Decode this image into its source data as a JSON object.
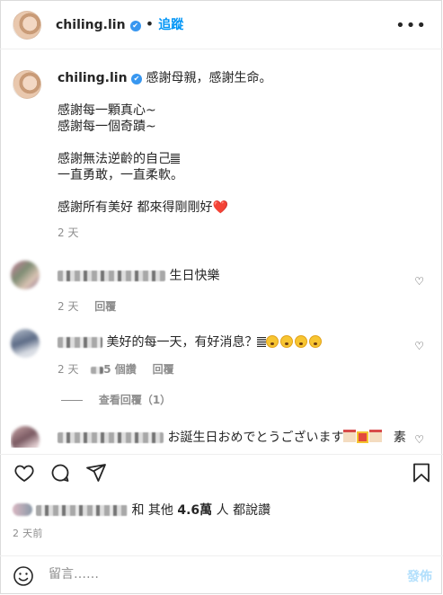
{
  "header": {
    "username": "chiling.lin",
    "verified": "✔",
    "separator": "•",
    "follow_label": "追蹤",
    "more_label": "•••"
  },
  "caption": {
    "username": "chiling.lin",
    "lines": [
      "感謝母親，感謝生命。",
      "",
      "感謝每一顆真心~",
      "感謝每一個奇蹟~",
      "",
      "感謝無法逆齡的自己",
      "一直勇敢，一直柔軟。",
      "",
      "感謝所有美好 都來得剛剛好❤️"
    ],
    "time": "2 天"
  },
  "comments": [
    {
      "text": "生日快樂",
      "time": "2 天",
      "reply_label": "回覆"
    },
    {
      "text": "美好的每一天，有好消息？",
      "time": "2 天",
      "likes": "5 個讚",
      "reply_label": "回覆",
      "view_replies": "查看回覆（1）"
    },
    {
      "text": "お誕生日おめでとうございます",
      "trailing": "素"
    }
  ],
  "likes": {
    "and_label": "和 其他",
    "count": "4.6萬",
    "suffix": "人 都說讚"
  },
  "post_time": "2 天前",
  "compose": {
    "placeholder": "留言……",
    "post_label": "發佈"
  },
  "icons": {
    "like": "heart-icon",
    "comment": "comment-icon",
    "share": "share-icon",
    "save": "bookmark-icon",
    "emoji": "emoji-icon",
    "verified": "verified-badge-icon",
    "more": "more-options-icon"
  }
}
